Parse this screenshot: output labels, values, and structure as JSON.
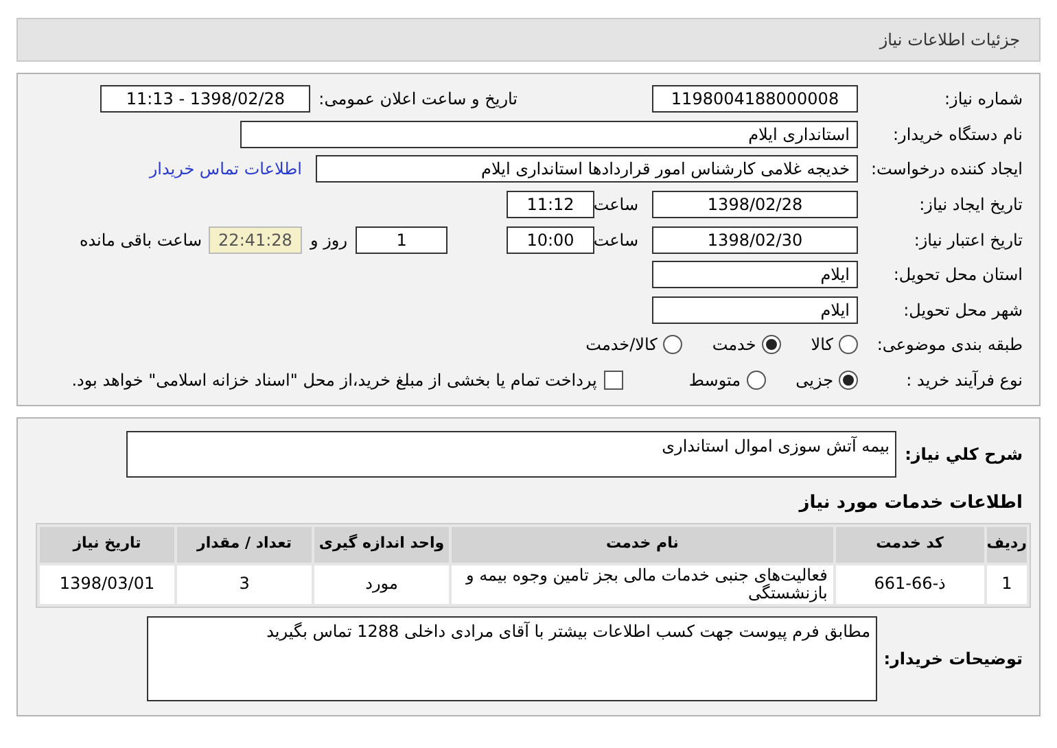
{
  "header": {
    "title": "جزئیات اطلاعات نیاز"
  },
  "need_number": {
    "label": "شماره نیاز:",
    "value": "1198004188000008"
  },
  "announce": {
    "label": "تاریخ و ساعت اعلان عمومی:",
    "value": "1398/02/28 - 11:13"
  },
  "buyer": {
    "label": "نام دستگاه خریدار:",
    "value": "استانداری ایلام"
  },
  "requester": {
    "label": "ایجاد کننده درخواست:",
    "value": "خدیجه غلامی کارشناس امور قراردادها استانداری ایلام",
    "link": "اطلاعات تماس خریدار"
  },
  "created": {
    "label": "تاریخ ایجاد نیاز:",
    "date": "1398/02/28",
    "time_label": "ساعت",
    "time": "11:12"
  },
  "validity": {
    "label": "تاریخ اعتبار نیاز:",
    "date": "1398/02/30",
    "time_label": "ساعت",
    "time": "10:00",
    "days": "1",
    "days_label": "روز و",
    "remaining": "22:41:28",
    "remaining_label": "ساعت باقی مانده"
  },
  "province": {
    "label": "استان محل تحویل:",
    "value": "ایلام"
  },
  "city": {
    "label": "شهر محل تحویل:",
    "value": "ایلام"
  },
  "category": {
    "label": "طبقه بندی موضوعی:",
    "options": [
      {
        "label": "کالا",
        "selected": false
      },
      {
        "label": "خدمت",
        "selected": true
      },
      {
        "label": "کالا/خدمت",
        "selected": false
      }
    ]
  },
  "process": {
    "label": "نوع فرآیند خرید :",
    "options": [
      {
        "label": "جزیی",
        "selected": true
      },
      {
        "label": "متوسط",
        "selected": false
      }
    ],
    "payment": {
      "checked": false,
      "text": "پرداخت تمام یا بخشی از مبلغ خرید،از محل \"اسناد خزانه اسلامی\" خواهد بود."
    }
  },
  "description": {
    "label": "شرح کلي نياز:",
    "value": "بیمه آتش سوزی اموال استانداری"
  },
  "services": {
    "title": "اطلاعات خدمات مورد نیاز",
    "columns": [
      "ردیف",
      "کد خدمت",
      "نام خدمت",
      "واحد اندازه گیری",
      "تعداد / مقدار",
      "تاریخ نیاز"
    ],
    "rows": [
      [
        "1",
        "ذ-66-661",
        "فعالیت‌های جنبی خدمات مالی بجز تامین وجوه بیمه و بازنشستگی",
        "مورد",
        "3",
        "1398/03/01"
      ]
    ]
  },
  "buyer_notes": {
    "label": "توضیحات خریدار:",
    "value": "مطابق فرم پیوست جهت کسب اطلاعات بیشتر با آقای مرادی داخلی 1288 تماس بگیرید"
  }
}
